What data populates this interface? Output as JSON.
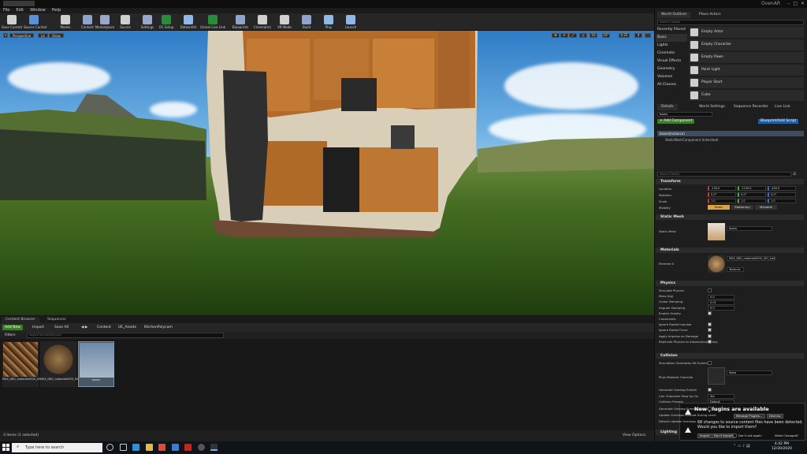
{
  "window": {
    "project_name": "OvenAR",
    "controls": [
      "–",
      "□",
      "✕"
    ]
  },
  "menu": [
    "File",
    "Edit",
    "Window",
    "Help"
  ],
  "toolbar": [
    {
      "label": "Save Current",
      "icon": "save-icon",
      "color": "#d0d0d0"
    },
    {
      "label": "Source Control",
      "icon": "source-control-icon",
      "color": "#5b8fd8"
    },
    {
      "label": "Modes",
      "icon": "modes-icon",
      "color": "#cfcfcf"
    },
    {
      "label": "Content",
      "icon": "content-icon",
      "color": "#8fa4c8"
    },
    {
      "label": "Marketplace",
      "icon": "marketplace-icon",
      "color": "#9aa7c8"
    },
    {
      "label": "Source",
      "icon": "source-icon",
      "color": "#cfcfcf"
    },
    {
      "label": "Settings",
      "icon": "settings-icon",
      "color": "#9aa7c8"
    },
    {
      "label": "OC Setup",
      "icon": "oc-setup-icon",
      "color": "#2a8c3a"
    },
    {
      "label": "Datasmith",
      "icon": "datasmith-icon",
      "color": "#8fb8e8"
    },
    {
      "label": "Unreal Live Link",
      "icon": "live-link-icon",
      "color": "#2a8c3a"
    },
    {
      "label": "Blueprints",
      "icon": "blueprints-icon",
      "color": "#8fa4c8"
    },
    {
      "label": "Cinematics",
      "icon": "cinematics-icon",
      "color": "#cfcfcf"
    },
    {
      "label": "VR Mode",
      "icon": "vr-mode-icon",
      "color": "#cfcfcf"
    },
    {
      "label": "Build",
      "icon": "build-icon",
      "color": "#8fa4c8"
    },
    {
      "label": "Play",
      "icon": "play-icon",
      "color": "#8fb8e8"
    },
    {
      "label": "Launch",
      "icon": "launch-icon",
      "color": "#8fb8e8"
    }
  ],
  "viewport": {
    "perspective_label": "Perspective",
    "lit_label": "Lit",
    "show_label": "Show",
    "grid_snap": "10",
    "rotation_snap": "10°",
    "scale_snap": "0.25",
    "camera_speed": "4"
  },
  "content_browser": {
    "tabs": [
      "Content Browser",
      "Sequencer"
    ],
    "add_new_label": "Add New",
    "import_label": "Import",
    "save_all_label": "Save All",
    "path": [
      "Content",
      "UE_Assets",
      "KitchenPolycam"
    ],
    "filters_label": "Filters",
    "search_placeholder": "Search KitchenPolycam",
    "assets": [
      {
        "name": "M0X_DB2_material0000_001_lib_plan_diffuse",
        "thumb": "#8a5a32"
      },
      {
        "name": "M0X_DB2_material0000_001_baked",
        "thumb": "#6a5030"
      },
      {
        "name": "boxes",
        "thumb": "#c9a070"
      }
    ],
    "status": "3 items (1 selected)",
    "view_options_label": "View Options"
  },
  "world_outliner": {
    "tabs": [
      "World Outliner",
      "Place Actors"
    ],
    "search_placeholder": "Search Classes",
    "categories": [
      "Recently Placed",
      "Basic",
      "Lights",
      "Cinematic",
      "Visual Effects",
      "Geometry",
      "Volumes",
      "All Classes"
    ],
    "items": [
      "Empty Actor",
      "Empty Character",
      "Empty Pawn",
      "Point Light",
      "Player Start",
      "Cube"
    ]
  },
  "details": {
    "tabs": [
      "Details",
      "World Settings",
      "Sequence Recorder",
      "Live Link"
    ],
    "actor_name": "boxes",
    "add_component_label": "+ Add Component",
    "blueprint_label": "Blueprint/Add Script",
    "components": [
      "boxes(Instance)",
      "StaticMeshComponent (Inherited)"
    ],
    "search_placeholder": "Search Details",
    "sections": {
      "transform": "Transform",
      "static_mesh": "Static Mesh",
      "materials": "Materials",
      "physics": "Physics",
      "collision": "Collision",
      "lighting": "Lighting"
    },
    "transform": {
      "location_label": "Location",
      "rotation_label": "Rotation",
      "scale_label": "Scale",
      "mobility_label": "Mobility",
      "location": [
        "-130.0",
        "-1130.0",
        "-400.0"
      ],
      "rotation": [
        "0.0°",
        "0.0°",
        "0.0°"
      ],
      "scale": [
        "1.0",
        "1.0",
        "1.0"
      ],
      "mobility": [
        "Static",
        "Stationary",
        "Movable"
      ]
    },
    "static_mesh": {
      "label": "Static Mesh",
      "value": "boxes"
    },
    "materials": {
      "label": "Element 0",
      "value": "M0X_DB2_material0000_001_baked",
      "mode": "Textures"
    },
    "physics": {
      "props": [
        "Simulate Physics",
        "Mass (kg)",
        "Linear Damping",
        "Angular Damping",
        "Enable Gravity",
        "Constraints",
        "Ignore Radial Impulse",
        "Ignore Radial Force",
        "Apply Impulse on Damage",
        "Replicate Physics to Autonomous Proxy"
      ],
      "mass": "0.0",
      "linear_damping": "0.01",
      "angular_damping": "0.0"
    },
    "collision": {
      "props": [
        "Simulation Generates Hit Events",
        "Phys Material Override",
        "Generate Overlap Events",
        "Can Character Step Up On",
        "Collision Presets",
        "Generate Overlap Events During Level",
        "Update Overlaps Method During Level",
        "Default Update Overlaps"
      ],
      "phys_material": "None",
      "step_up": "Yes",
      "presets": "Default"
    }
  },
  "notifications": {
    "title": "New plugins are available",
    "manage_label": "Manage Plugins...",
    "dismiss_label": "Dismiss",
    "message": "68 changes to source content files have been detected. Would you like to import them?",
    "import_label": "Import",
    "dont_import_label": "Don't Import",
    "dont_ask_label": "Don't ask again",
    "what_changed_label": "What Changed?"
  },
  "taskbar": {
    "search_placeholder": "Type here to search",
    "time": "4:42 PM",
    "date": "12/30/2020"
  }
}
